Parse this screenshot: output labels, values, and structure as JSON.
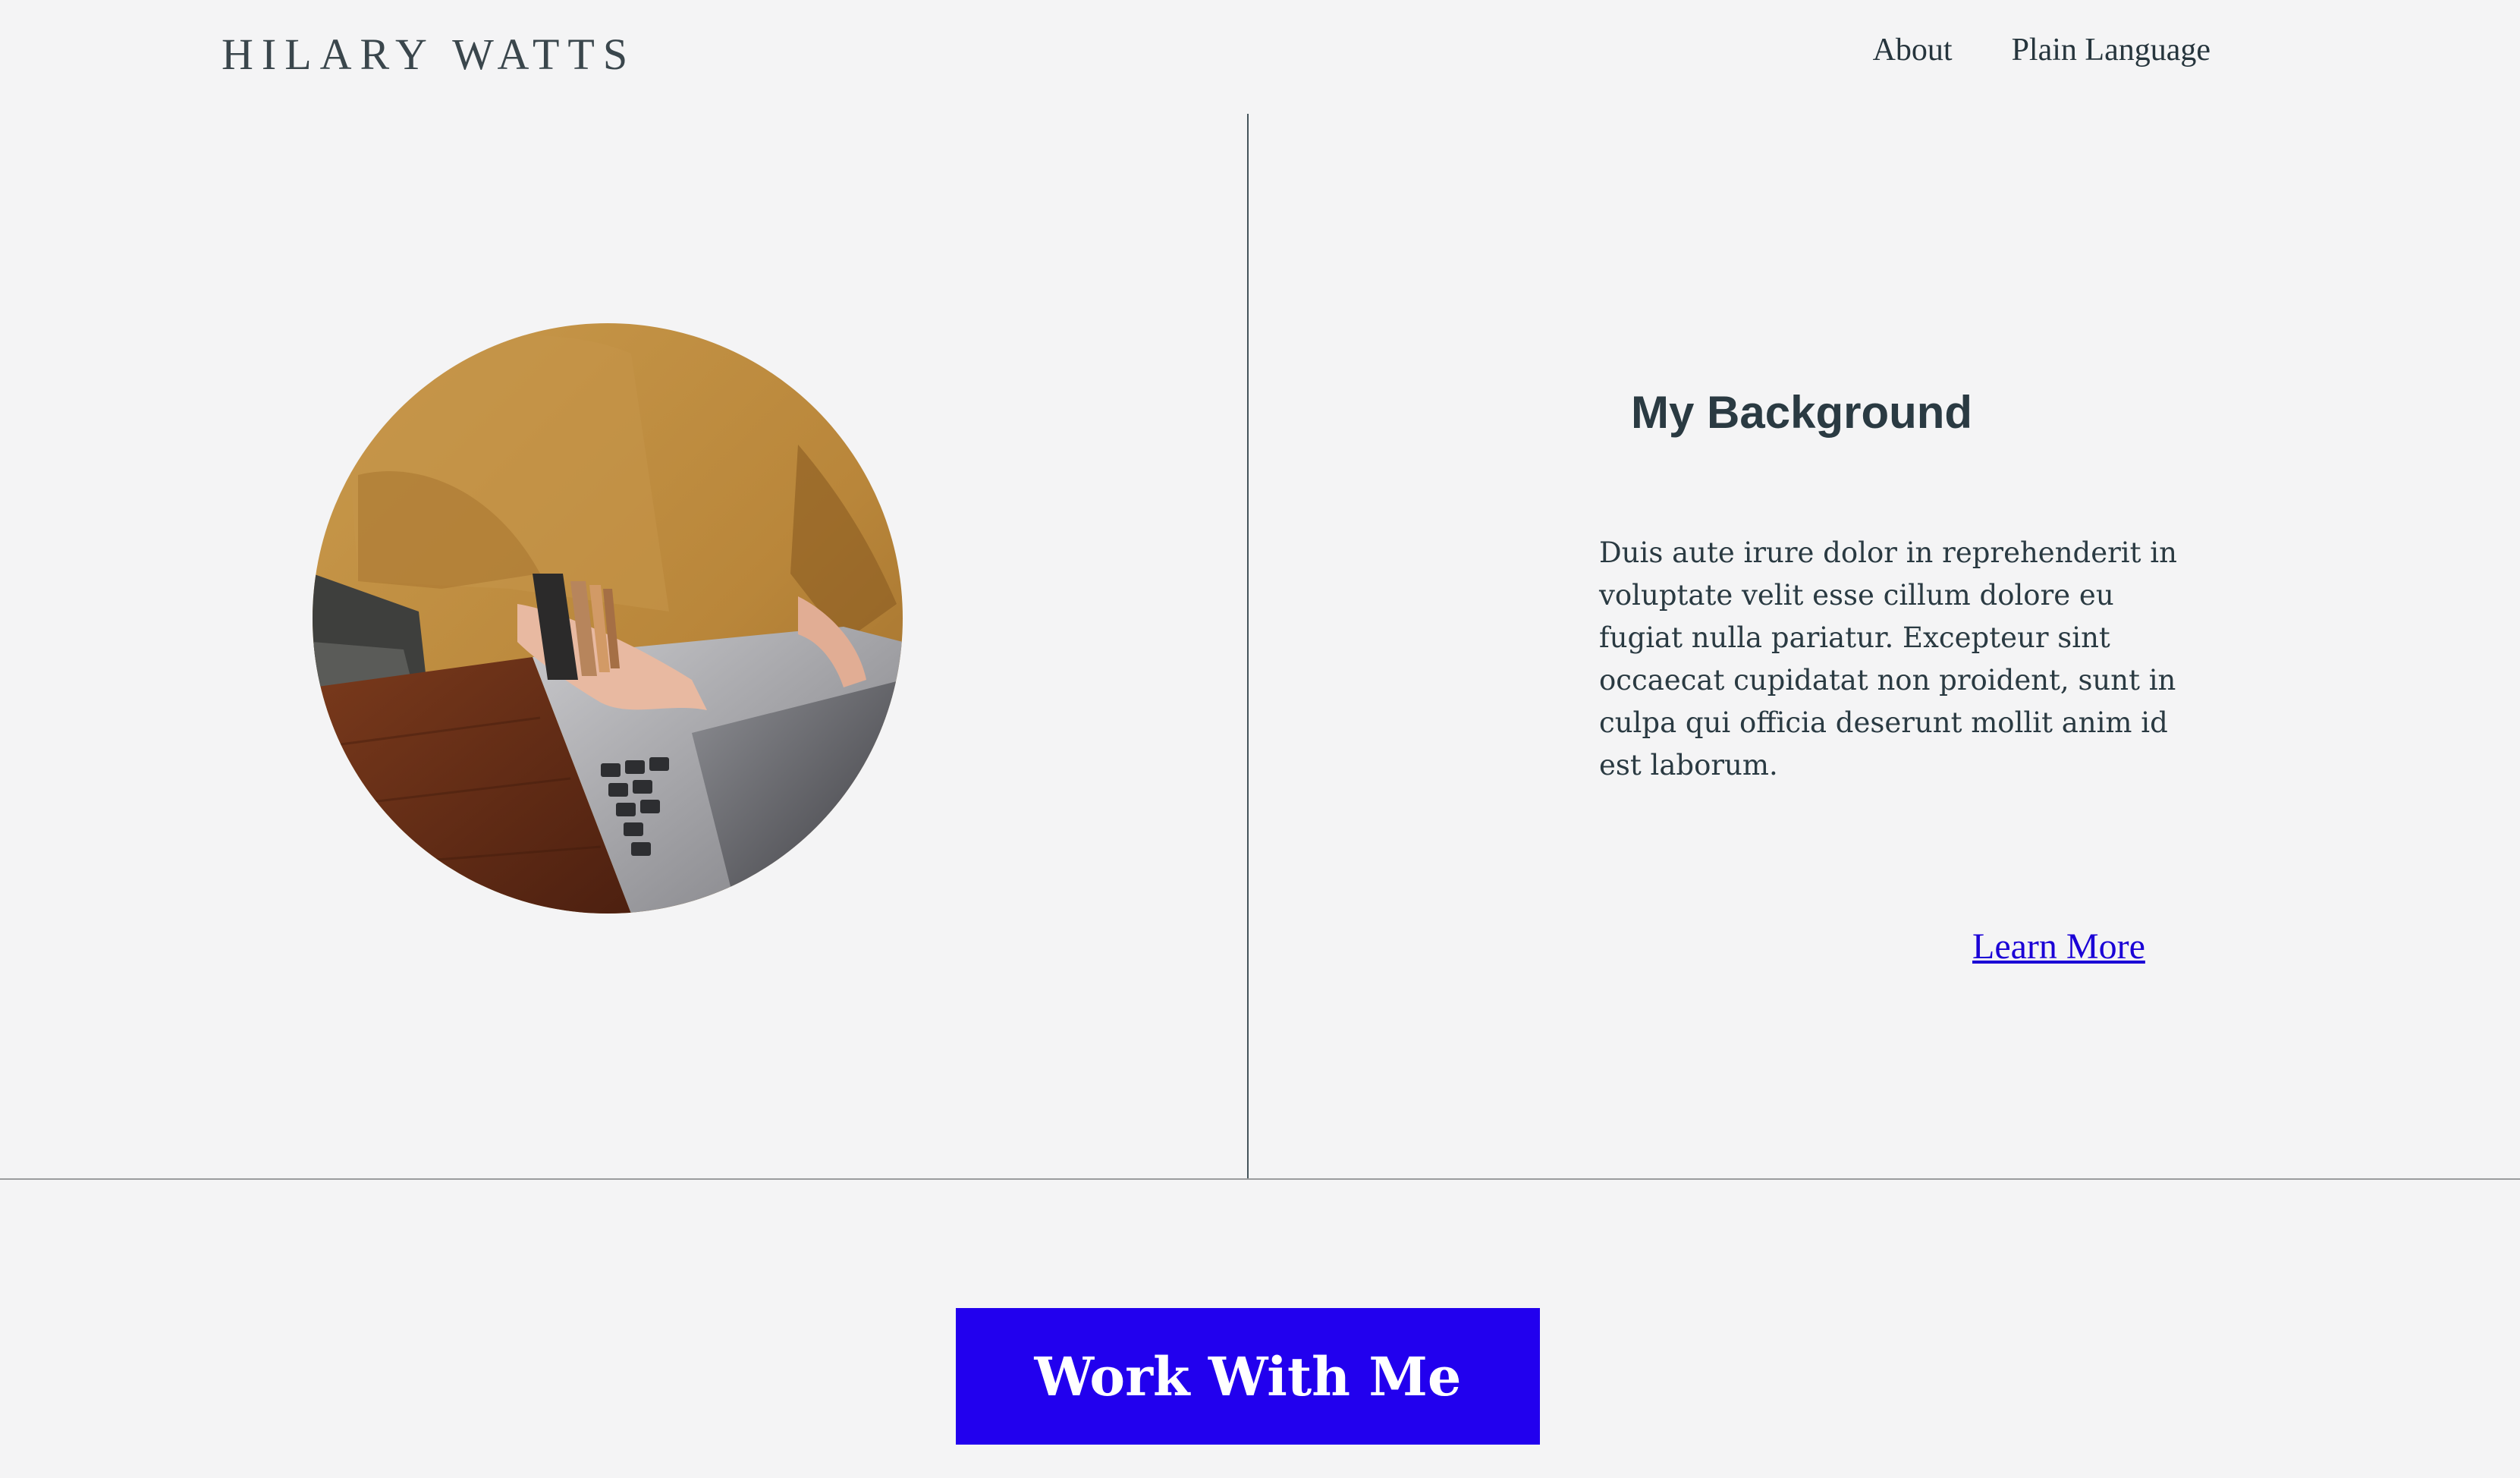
{
  "header": {
    "logo": "HILARY WATTS",
    "nav": [
      {
        "label": "About"
      },
      {
        "label": "Plain Language"
      }
    ]
  },
  "background_section": {
    "heading": "My Background",
    "body": "Duis aute irure dolor in reprehenderit in voluptate velit esse cillum dolore eu fugiat nulla pariatur. Excepteur sint occaecat cupidatat non proident, sunt in culpa qui officia deserunt mollit anim id est laborum.",
    "link_label": "Learn More"
  },
  "cta": {
    "label": "Work With Me"
  },
  "colors": {
    "page_background": "#f4f4f5",
    "text": "#26353d",
    "link": "#1a00d6",
    "cta_background": "#2200ee",
    "cta_text": "#ffffff"
  }
}
